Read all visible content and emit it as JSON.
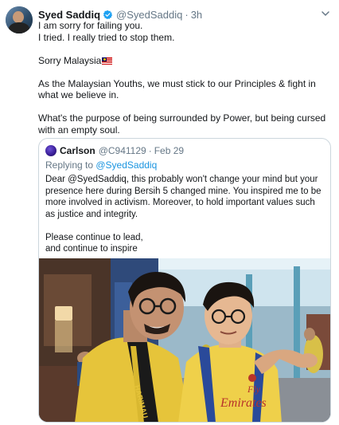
{
  "tweet": {
    "author_name": "Syed Saddiq",
    "author_handle": "@SyedSaddiq",
    "separator": "·",
    "time": "3h",
    "lines": [
      "I am sorry for failing you.",
      "I tried. I really tried to stop them."
    ],
    "sorry_text": "Sorry Malaysia",
    "para2": "As the Malaysian Youths, we must stick to our Principles & fight in what we believe in.",
    "para3": "What's the purpose of being surrounded by Power, but being cursed with an empty soul."
  },
  "quoted": {
    "author_name": "Carlson",
    "author_handle": "@C941129",
    "separator": "·",
    "date": "Feb 29",
    "replying_prefix": "Replying to ",
    "replying_handle": "@SyedSaddiq",
    "para1": "Dear @SyedSaddiq, this probably won't change your mind but your presence here during Bersih 5 changed mine. You inspired me to be more involved in activism. Moreover, to hold important values such as justice and integrity.",
    "closing": [
      "Please continue to lead,",
      "and continue to inspire"
    ],
    "photo_shirt_text": [
      "Fly",
      "Emirates"
    ]
  },
  "colors": {
    "link": "#1b95e0",
    "secondary": "#657786",
    "verified": "#1da1f2",
    "border": "#ccd6dd"
  },
  "icons": {
    "verified": "verified-badge-icon",
    "caret": "chevron-down-icon",
    "flag": "malaysia-flag-emoji"
  }
}
